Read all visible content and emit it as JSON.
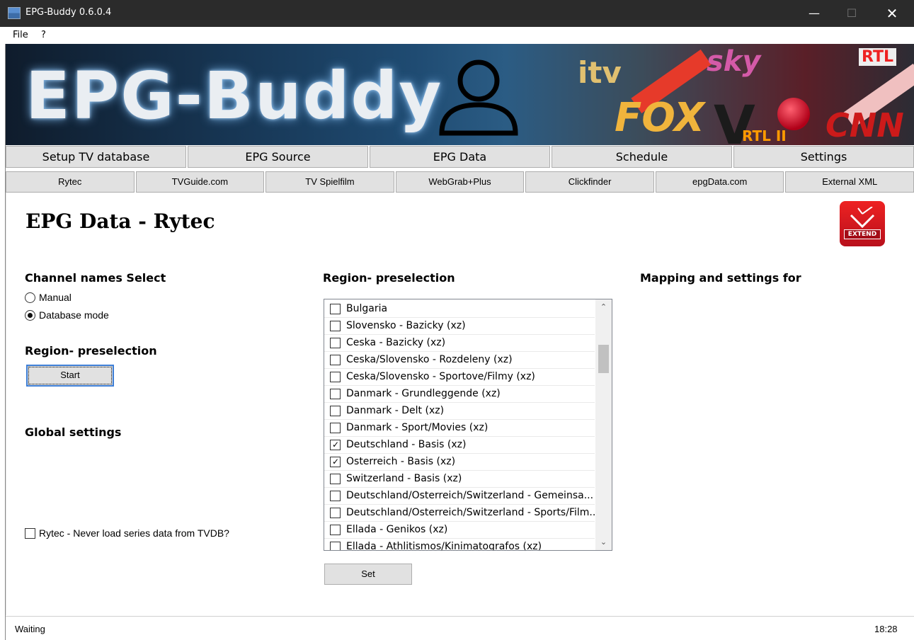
{
  "window": {
    "title": "EPG-Buddy 0.6.0.4",
    "min_glyph": "—",
    "max_glyph": "☐",
    "close_glyph": "✕"
  },
  "menu": {
    "file": "File",
    "help": "?"
  },
  "banner": {
    "title": "EPG-Buddy",
    "logos": {
      "itv": "itv",
      "fox": "FOX",
      "sky": "sky",
      "rtl": "RTL",
      "cnn": "CNN",
      "rtl2": "RTL II",
      "vox": "V"
    }
  },
  "main_tabs": [
    "Setup TV database",
    "EPG Source",
    "EPG Data",
    "Schedule",
    "Settings"
  ],
  "sub_tabs": [
    "Rytec",
    "TVGuide.com",
    "TV Spielfilm",
    "WebGrab+Plus",
    "Clickfinder",
    "epgData.com",
    "External XML"
  ],
  "page": {
    "title": "EPG Data - Rytec",
    "extend_label": "EXTEND"
  },
  "channel_names": {
    "heading": "Channel names Select",
    "options": [
      {
        "label": "Manual",
        "selected": false
      },
      {
        "label": "Database mode",
        "selected": true
      }
    ]
  },
  "region_left": {
    "heading": "Region- preselection",
    "start_button": "Start"
  },
  "global_settings": {
    "heading": "Global settings",
    "never_load_label": "Rytec - Never load series data from TVDB?",
    "never_load_checked": false
  },
  "region_list": {
    "heading": "Region- preselection",
    "items": [
      {
        "label": "Bulgaria",
        "checked": false
      },
      {
        "label": "Slovensko - Bazicky (xz)",
        "checked": false
      },
      {
        "label": "Ceska - Bazicky (xz)",
        "checked": false
      },
      {
        "label": "Ceska/Slovensko - Rozdeleny (xz)",
        "checked": false
      },
      {
        "label": "Ceska/Slovensko - Sportove/Filmy (xz)",
        "checked": false
      },
      {
        "label": "Danmark - Grundleggende (xz)",
        "checked": false
      },
      {
        "label": "Danmark - Delt (xz)",
        "checked": false
      },
      {
        "label": "Danmark - Sport/Movies (xz)",
        "checked": false
      },
      {
        "label": "Deutschland - Basis  (xz)",
        "checked": true
      },
      {
        "label": "Osterreich - Basis  (xz)",
        "checked": true
      },
      {
        "label": "Switzerland - Basis  (xz)",
        "checked": false
      },
      {
        "label": "Deutschland/Osterreich/Switzerland - Gemeinsa...",
        "checked": false
      },
      {
        "label": "Deutschland/Osterreich/Switzerland - Sports/Film...",
        "checked": false
      },
      {
        "label": "Ellada - Genikos (xz)",
        "checked": false
      },
      {
        "label": "Ellada - Athlitismos/Kinimatografos (xz)",
        "checked": false
      }
    ],
    "set_button": "Set",
    "scroll_up_glyph": "⌃",
    "scroll_down_glyph": "⌄"
  },
  "mapping": {
    "heading": "Mapping and settings for"
  },
  "status": {
    "left": "Waiting",
    "right": "18:28"
  },
  "colors": {
    "titlebar": "#2b2b2b",
    "accent": "#3d7ed6",
    "extend_red": "#d8141f"
  }
}
